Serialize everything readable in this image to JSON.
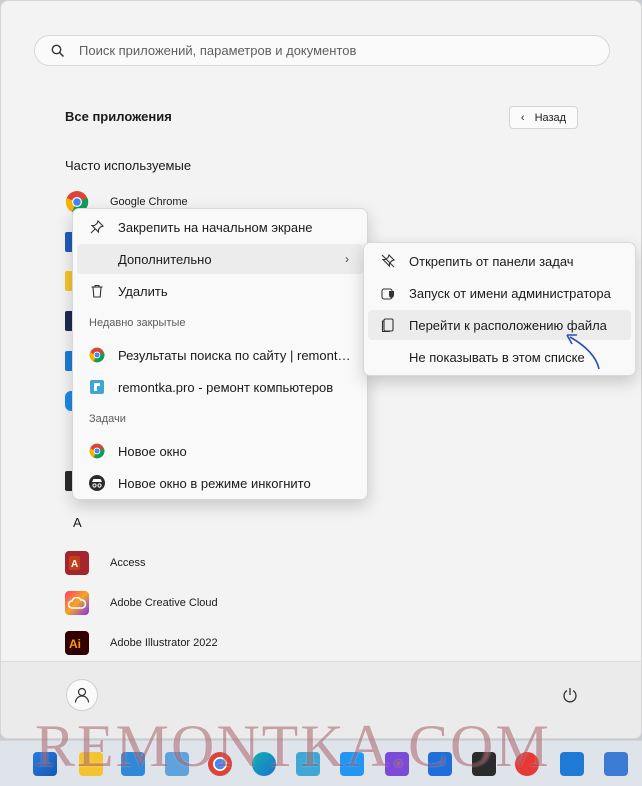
{
  "search": {
    "placeholder": "Поиск приложений, параметров и документов"
  },
  "header": {
    "title": "Все приложения",
    "back_label": "Назад"
  },
  "frequent": {
    "title": "Часто используемые",
    "first_app": "Google Chrome"
  },
  "letter": "A",
  "apps": [
    {
      "label": "Access",
      "icon": "access-icon"
    },
    {
      "label": "Adobe Creative Cloud",
      "icon": "creative-cloud-icon"
    },
    {
      "label": "Adobe Illustrator 2022",
      "icon": "illustrator-icon"
    }
  ],
  "context_menu": {
    "pin": "Закрепить на начальном экране",
    "more": "Дополнительно",
    "delete": "Удалить",
    "recent_header": "Недавно закрытые",
    "recent": [
      "Результаты поиска по сайту | remontka.pro",
      "remontka.pro - ремонт компьютеров"
    ],
    "tasks_header": "Задачи",
    "tasks": [
      "Новое окно",
      "Новое окно в режиме инкогнито"
    ]
  },
  "submenu": {
    "unpin_taskbar": "Открепить от панели задач",
    "run_admin": "Запуск от имени администратора",
    "open_location": "Перейти к расположению файла",
    "hide_list": "Не показывать в этом списке"
  },
  "watermark": "REMONTKA.COM",
  "colors": {
    "chrome_red": "#db4437",
    "chrome_yellow": "#f4b400",
    "chrome_green": "#0f9d58",
    "chrome_blue": "#4285f4",
    "annotation_arrow": "#2b4fb3"
  }
}
